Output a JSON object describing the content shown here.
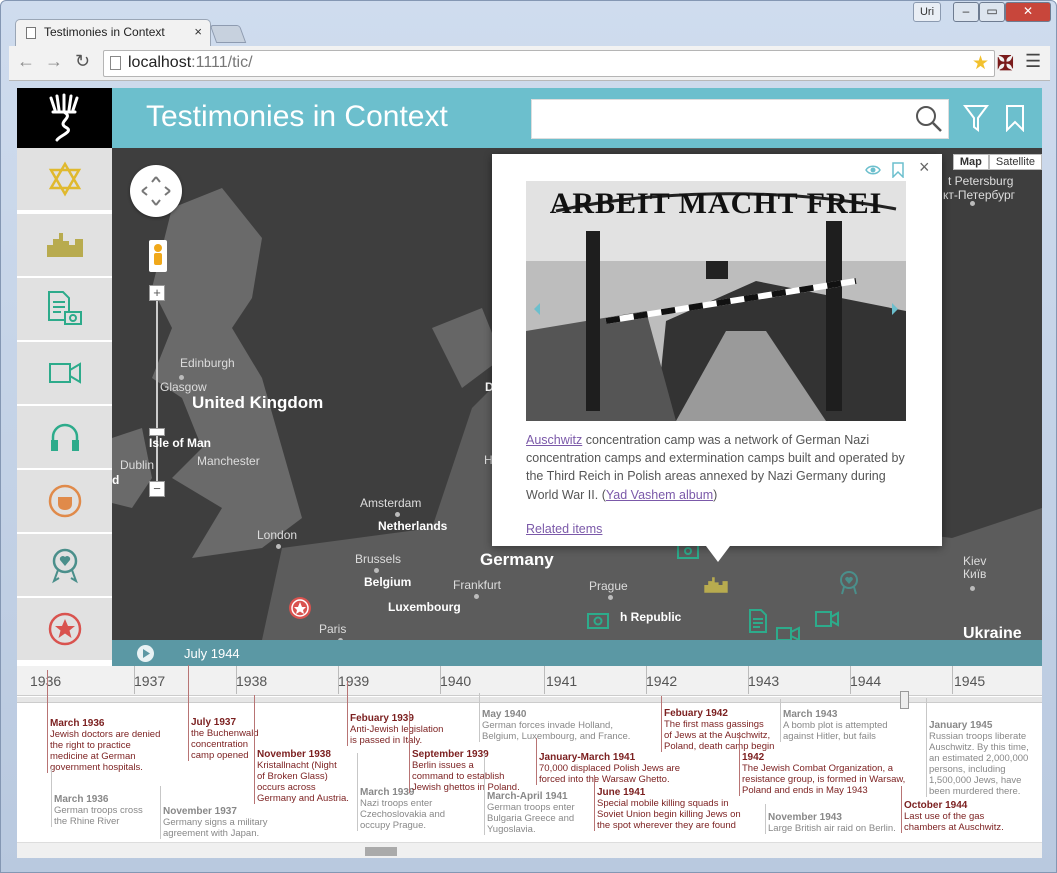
{
  "browser": {
    "tab_title": "Testimonies in Context",
    "tab_close": "×",
    "user": "Uri",
    "url_host": "localhost",
    "url_path": ":1111/tic/",
    "min": "–",
    "max": "▭",
    "close": "✕"
  },
  "app": {
    "title": "Testimonies in Context"
  },
  "map": {
    "type_map": "Map",
    "type_satellite": "Satellite",
    "labels": {
      "united_kingdom": "United Kingdom",
      "edinburgh": "Edinburgh",
      "glasgow": "Glasgow",
      "isle_of_man": "Isle of Man",
      "dublin": "Dublin",
      "manchester": "Manchester",
      "london": "London",
      "paris": "Paris",
      "amsterdam": "Amsterdam",
      "netherlands": "Netherlands",
      "brussels": "Brussels",
      "belgium": "Belgium",
      "luxembourg": "Luxembourg",
      "germany": "Germany",
      "frankfurt": "Frankfurt",
      "prague": "Prague",
      "czech": "h Republic",
      "st_petersburg": "t Petersburg",
      "st_petersburg_cyr": "кт-Петербург",
      "kiev": "Kiev",
      "kiev_cyr": "Київ",
      "ukraine": "Ukraine",
      "d1": "D",
      "h1": "H",
      "l1": "d"
    }
  },
  "popup": {
    "link_text": "Auschwitz",
    "body": " concentration camp was a network of German Nazi concentration camps and extermination camps built and operated by the Third Reich in Polish areas annexed by Nazi Germany during World War II. (",
    "album": "Yad Vashem album",
    "body_end": ")",
    "related": "Related items",
    "photo_sign": "ARBEIT MACHT FREI",
    "close": "×"
  },
  "playbar": {
    "date": "July 1944"
  },
  "timeline": {
    "years": [
      "1936",
      "1937",
      "1938",
      "1939",
      "1940",
      "1941",
      "1942",
      "1943",
      "1944",
      "1945"
    ],
    "events": [
      {
        "title": "March 1936",
        "text": "Jewish doctors are denied\nthe right to practice\nmedicine at German\ngovernment hospitals."
      },
      {
        "title": "March 1936",
        "text": "German troops cross\nthe Rhine River"
      },
      {
        "title": "July 1937",
        "text": "the Buchenwald\nconcentration\ncamp opened"
      },
      {
        "title": "November 1937",
        "text": "Germany signs a military\nagreement with Japan."
      },
      {
        "title": "November 1938",
        "text": "Kristallnacht (Night\nof Broken Glass)\noccurs across\nGermany and Austria."
      },
      {
        "title": "Febuary 1939",
        "text": "Anti-Jewish legislation\nis passed in Italy."
      },
      {
        "title": "March 1939",
        "text": "Nazi troops enter\nCzechoslovakia and\noccupy Prague."
      },
      {
        "title": "September 1939",
        "text": "Berlin issues a\ncommand to establish\nJewish ghettos in Poland."
      },
      {
        "title": "May 1940",
        "text": "German forces invade Holland,\nBelgium, Luxembourg, and France."
      },
      {
        "title": "January-March 1941",
        "text": "70,000 displaced Polish Jews are\nforced into the Warsaw Ghetto."
      },
      {
        "title": "March-April 1941",
        "text": "German troops enter\nBulgaria Greece and\nYugoslavia."
      },
      {
        "title": "June 1941",
        "text": "Special mobile killing squads in\nSoviet Union begin killing Jews on\nthe spot wherever they are found"
      },
      {
        "title": "Febuary 1942",
        "text": "The first mass gassings\nof Jews at the Auschwitz,\nPoland, death camp begin"
      },
      {
        "title": "1942",
        "text": "The Jewish Combat Organization, a\nresistance group, is formed in Warsaw,\nPoland and ends in May 1943"
      },
      {
        "title": "March 1943",
        "text": "A bomb plot is attempted\nagainst Hitler, but fails"
      },
      {
        "title": "November 1943",
        "text": "Large British air raid on Berlin."
      },
      {
        "title": "January 1945",
        "text": "Russian troops liberate\nAuschwitz. By this time,\nan estimated 2,000,000\npersons, including\n1,500,000 Jews, have\nbeen murdered there."
      },
      {
        "title": "October 1944",
        "text": "Last use of the gas\nchambers at Auschwitz."
      }
    ]
  },
  "colors": {
    "header": "#6cbfcd",
    "playbar": "#5b98a4",
    "yellow": "#e0b92e",
    "olive": "#b8ab4f",
    "teal": "#2dab8b",
    "orange": "#e08a4a",
    "red": "#d9534f",
    "event_red": "#7b1f1f"
  }
}
